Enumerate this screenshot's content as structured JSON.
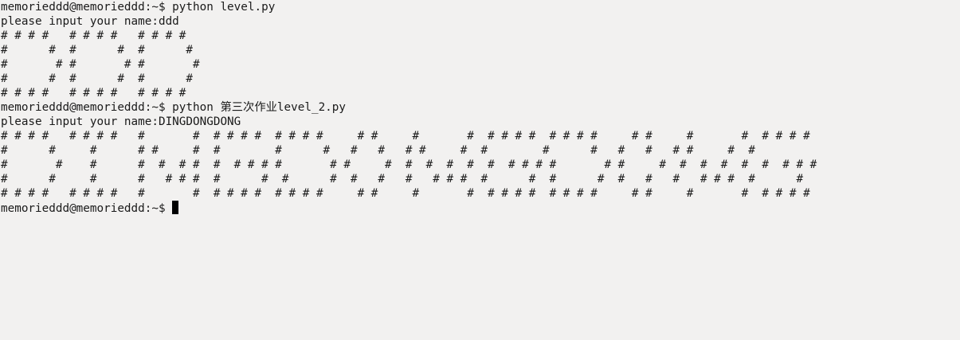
{
  "terminal": {
    "lines": [
      "memorieddd@memorieddd:~$ python level.py",
      "please input your name:ddd",
      "# # # #   # # # #   # # # #",
      "#      #  #      #  #      #",
      "#       # #       # #       #",
      "#      #  #      #  #      #",
      "# # # #   # # # #   # # # #",
      "memorieddd@memorieddd:~$ python 第三次作业level_2.py",
      "please input your name:DINGDONGDONG",
      "# # # #   # # # #   #       #  # # # #  # # # #     # #     #       #  # # # #  # # # #     # #     #       #  # # # #",
      "#      #     #      # #     #  #        #      #   #   #   # #     #  #        #      #   #   #   # #     #  #",
      "#       #    #      #  #  # #  #  # # # #       # #     #  #  #  #  #  #  # # # #       # #     #  #  #  #  #  #  # # #",
      "#      #     #      #   # # #  #      #  #      #  #   #   #   # # #  #      #  #      #  #   #   #   # # #  #      #",
      "# # # #   # # # #   #       #  # # # #  # # # #     # #     #       #  # # # #  # # # #     # #     #       #  # # # #"
    ],
    "prompt": "memorieddd@memorieddd:~$ "
  }
}
